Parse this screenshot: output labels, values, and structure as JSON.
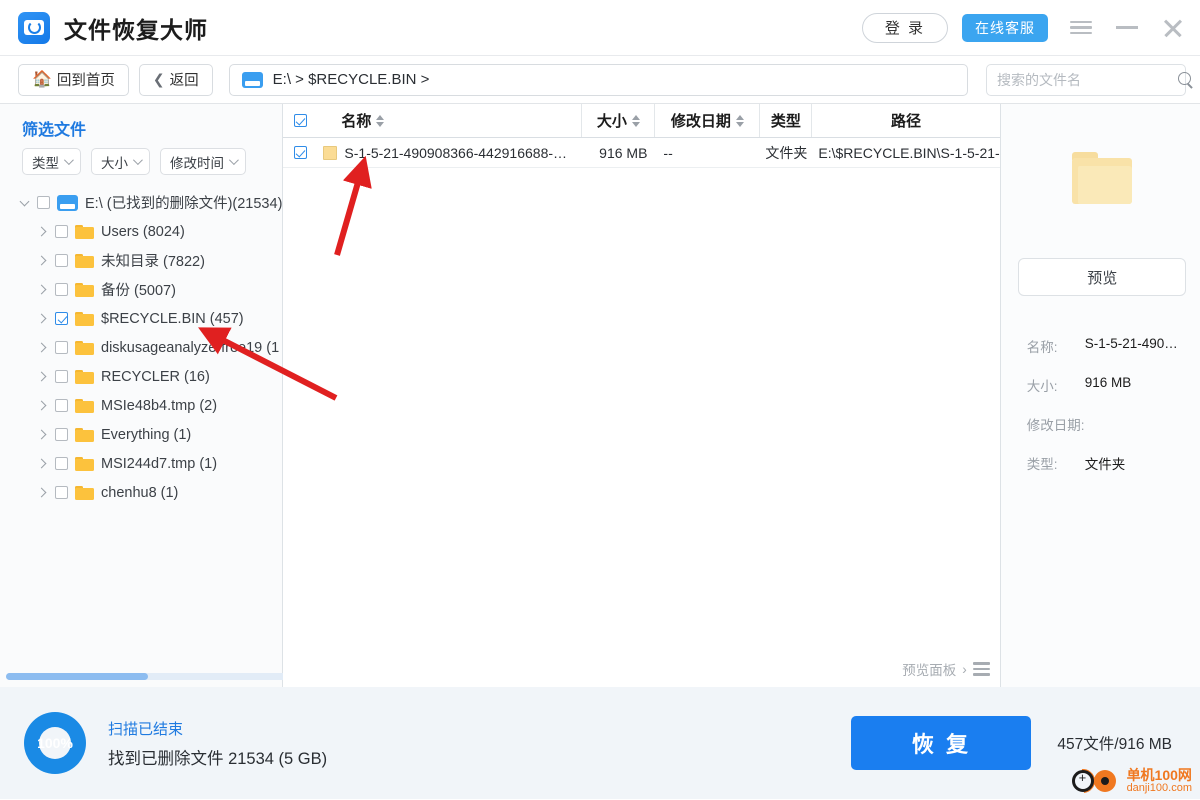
{
  "window": {
    "app_title": "文件恢复大师",
    "app_icon": "disk-recovery-icon",
    "login_label": "登 录",
    "service_label": "在线客服",
    "menu_icon": "hamburger-icon",
    "minimize_icon": "minimize-icon",
    "close_icon": "close-icon"
  },
  "toolbar": {
    "home_label": "回到首页",
    "home_icon": "home-icon",
    "back_label": "返回",
    "back_icon": "chevron-left-icon",
    "breadcrumb": "E:\\ > $RECYCLE.BIN >",
    "drive_icon": "drive-icon",
    "search_placeholder": "搜索的文件名",
    "search_value": "",
    "search_icon": "search-icon"
  },
  "sidebar": {
    "filter_title": "筛选文件",
    "filters": [
      {
        "label": "类型"
      },
      {
        "label": "大小"
      },
      {
        "label": "修改时间"
      }
    ],
    "tree": [
      {
        "label": "E:\\ (已找到的删除文件)(21534)",
        "icon": "drive-icon",
        "checked": false,
        "expanded": true,
        "level": 0
      },
      {
        "label": "Users (8024)",
        "icon": "folder-icon",
        "checked": false,
        "expanded": false,
        "level": 1
      },
      {
        "label": "未知目录 (7822)",
        "icon": "folder-icon",
        "checked": false,
        "expanded": false,
        "level": 1
      },
      {
        "label": "备份 (5007)",
        "icon": "folder-icon",
        "checked": false,
        "expanded": false,
        "level": 1
      },
      {
        "label": "$RECYCLE.BIN (457)",
        "icon": "folder-icon",
        "checked": true,
        "expanded": false,
        "level": 1
      },
      {
        "label": "diskusageanalyzerfree19 (1",
        "icon": "folder-icon",
        "checked": false,
        "expanded": false,
        "level": 1
      },
      {
        "label": "RECYCLER (16)",
        "icon": "folder-icon",
        "checked": false,
        "expanded": false,
        "level": 1
      },
      {
        "label": "MSIe48b4.tmp (2)",
        "icon": "folder-icon",
        "checked": false,
        "expanded": false,
        "level": 1
      },
      {
        "label": "Everything (1)",
        "icon": "folder-icon",
        "checked": false,
        "expanded": false,
        "level": 1
      },
      {
        "label": "MSI244d7.tmp (1)",
        "icon": "folder-icon",
        "checked": false,
        "expanded": false,
        "level": 1
      },
      {
        "label": "chenhu8 (1)",
        "icon": "folder-icon",
        "checked": false,
        "expanded": false,
        "level": 1
      }
    ]
  },
  "filetable": {
    "select_all_checked": true,
    "columns": {
      "name": "名称",
      "size": "大小",
      "date": "修改日期",
      "type": "类型",
      "path": "路径"
    },
    "rows": [
      {
        "checked": true,
        "name": "S-1-5-21-490908366-442916688-…",
        "size": "916 MB",
        "date": "--",
        "type": "文件夹",
        "path": "E:\\$RECYCLE.BIN\\S-1-5-21-"
      }
    ],
    "preview_panel_toggle": "预览面板",
    "preview_panel_chevron": "›",
    "preview_panel_icon": "list-icon"
  },
  "preview": {
    "folder_icon": "folder-icon-large",
    "preview_button": "预览",
    "fields": [
      {
        "key": "名称:",
        "value": "S-1-5-21-490…"
      },
      {
        "key": "大小:",
        "value": "916 MB"
      },
      {
        "key": "修改日期:",
        "value": ""
      },
      {
        "key": "类型:",
        "value": "文件夹"
      }
    ]
  },
  "statusbar": {
    "progress_percent": "100%",
    "scan_status": "扫描已结束",
    "scan_detail": "找到已删除文件 21534 (5 GB)",
    "recover_label": "恢 复",
    "selection_info": "457文件/916 MB"
  },
  "watermark": {
    "site_name": "单机100网",
    "site_url": "danji100.com"
  },
  "colors": {
    "accent_blue": "#1a7ef0",
    "link_blue": "#1f7ae0",
    "service_blue": "#3ba5f0",
    "folder_yellow": "#fcc23d",
    "arrow_red": "#e02020"
  }
}
